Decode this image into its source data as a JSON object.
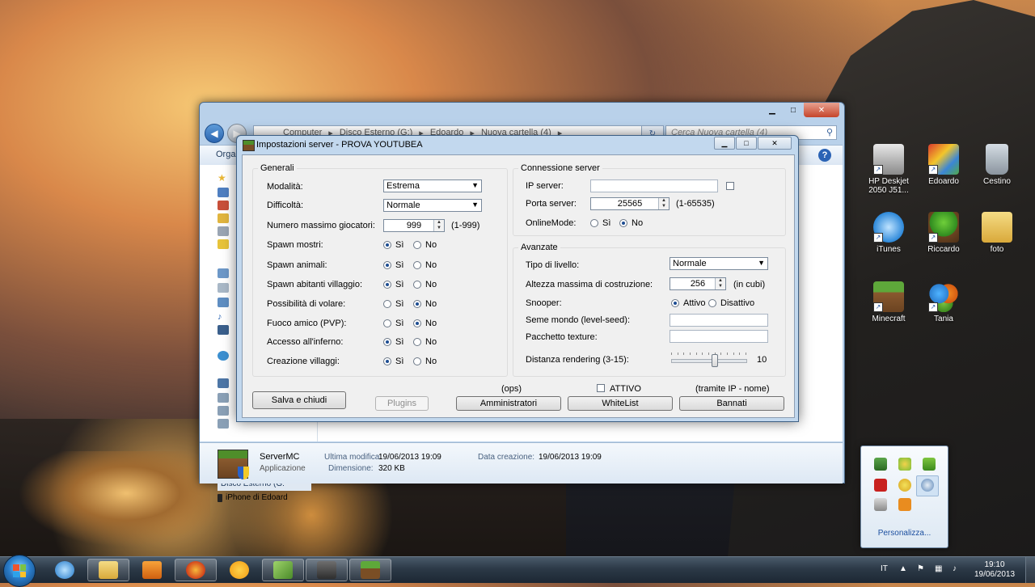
{
  "explorer": {
    "breadcrumb": [
      "Computer",
      "Disco Esterno (G:)",
      "Edoardo",
      "Nuova cartella (4)"
    ],
    "search_placeholder": "Cerca Nuova cartella (4)",
    "organize": "Orga",
    "sidebar": {
      "drive": "Disco Esterno (G:",
      "iphone": "iPhone di Edoard"
    },
    "details": {
      "name": "ServerMC",
      "type": "Applicazione",
      "modified_label": "Ultima modifica:",
      "modified_value": "19/06/2013 19:09",
      "size_label": "Dimensione:",
      "size_value": "320 KB",
      "created_label": "Data creazione:",
      "created_value": "19/06/2013 19:09"
    }
  },
  "dialog": {
    "title": "Impostazioni server - PROVA YOUTUBEA",
    "generali": {
      "group": "Generali",
      "modalita_label": "Modalità:",
      "modalita_value": "Estrema",
      "difficolta_label": "Difficoltà:",
      "difficolta_value": "Normale",
      "max_label": "Numero massimo giocatori:",
      "max_value": "999",
      "max_range": "(1-999)",
      "si": "Sì",
      "no": "No",
      "options": [
        {
          "label": "Spawn mostri:",
          "value": "Sì"
        },
        {
          "label": "Spawn animali:",
          "value": "Sì"
        },
        {
          "label": "Spawn abitanti villaggio:",
          "value": "Sì"
        },
        {
          "label": "Possibilità di volare:",
          "value": "No"
        },
        {
          "label": "Fuoco amico (PVP):",
          "value": "No"
        },
        {
          "label": "Accesso all'inferno:",
          "value": "Sì"
        },
        {
          "label": "Creazione villaggi:",
          "value": "Sì"
        }
      ]
    },
    "connessione": {
      "group": "Connessione server",
      "ip_label": "IP server:",
      "ip_value": "",
      "porta_label": "Porta server:",
      "porta_value": "25565",
      "porta_range": "(1-65535)",
      "online_label": "OnlineMode:",
      "online_value": "No"
    },
    "avanzate": {
      "group": "Avanzate",
      "tipo_label": "Tipo di livello:",
      "tipo_value": "Normale",
      "altezza_label": "Altezza massima di costruzione:",
      "altezza_value": "256",
      "altezza_unit": "(in cubi)",
      "snooper_label": "Snooper:",
      "snooper_on": "Attivo",
      "snooper_off": "Disattivo",
      "snooper_value": "Attivo",
      "seed_label": "Seme mondo (level-seed):",
      "seed_value": "",
      "texture_label": "Pacchetto texture:",
      "texture_value": "",
      "distanza_label": "Distanza rendering (3-15):",
      "distanza_value": "10",
      "distanza_min": 3,
      "distanza_max": 15
    },
    "buttons": {
      "salva": "Salva e chiudi",
      "plugins": "Plugins",
      "ops_caption": "(ops)",
      "attivo_label": "ATTIVO",
      "attivo_checked": false,
      "tramite": "(tramite IP - nome)",
      "amministratori": "Amministratori",
      "whitelist": "WhiteList",
      "bannati": "Bannati"
    }
  },
  "desktop_icons": [
    {
      "label": "HP Deskjet 2050 J51...",
      "icon": "printer-icon"
    },
    {
      "label": "Edoardo",
      "icon": "program-icon"
    },
    {
      "label": "Cestino",
      "icon": "recycle-bin-icon"
    },
    {
      "label": "iTunes",
      "icon": "itunes-icon"
    },
    {
      "label": "Riccardo",
      "icon": "tree-icon"
    },
    {
      "label": "foto",
      "icon": "folder-icon"
    },
    {
      "label": "Minecraft",
      "icon": "minecraft-icon"
    },
    {
      "label": "Tania",
      "icon": "msn-icon"
    }
  ],
  "tray": {
    "personalizza": "Personalizza...",
    "language": "IT",
    "time": "19:10",
    "date": "19/06/2013"
  }
}
